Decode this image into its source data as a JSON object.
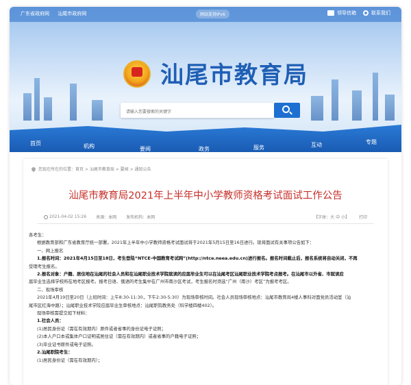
{
  "topbar": {
    "links": [
      "广东省政府网",
      "汕尾市政府网"
    ],
    "center": "网站支持IPv6",
    "email": "领导信箱",
    "contact": "联系我们"
  },
  "header": {
    "site_title": "汕尾市教育局",
    "search_placeholder": "请输入您要搜索的关键字"
  },
  "nav": {
    "items": [
      "首页",
      "机构",
      "要闻",
      "政务",
      "服务",
      "互动",
      "专题"
    ]
  },
  "breadcrumb": "您现在所在的位置：首页 > 汕尾市教育局 > 要闻 > 通知公告",
  "article": {
    "title": "汕尾市教育局2021年上半年中小学教师资格考试面试工作公告",
    "date": "2021-04-02 15:26",
    "source": "来源：本网",
    "publisher": "发布机构：本网",
    "font_size": "【字体：大 中 小】",
    "print": "打印",
    "paragraphs": [
      "各考生：",
      "根据教育部和广东省教育厅统一部署，2021年上半年中小学教师资格考试面试将于2021年5月15日至16日进行。现将面试有关事项公告如下：",
      "一、网上报名",
      "1.报名时间：2021年4月15日至18日，考生登陆“NTCE-中国教育考试网”(http://ntce.neea.edu.cn)进行报名。报名时间截止后，报名系统将自动关闭，不再",
      "受理考生报名。",
      "2.报名对象：户籍、居住地在汕尾的社会人员和在汕尾职业技术学院就读的应届毕业生可以在汕尾考区汕尾职业技术学院考点报考。在汕尾市以外省、市就读应",
      "届毕业生选择学校所在地考区报考。报考日语、俄语的考生集中在广州市南沙区考试，考生报名时须选“广州（南沙）考区”为报考考区。",
      "二、现场审核",
      "2021年4月19日至20日（上班时间：上午8:30-11:30，下午2:30-5:30）为现场审核时间。社会人员现场审核地点：汕尾市教育局4楼人事科对面党员活动室（汕",
      "尾市区红海中路）；汕尾职业技术学院应届毕业生审核地点：汕尾职院教务处（科学楼四楼402）。",
      "现场审核需提交如下材料：",
      "1.社会人员：",
      "(1)居民身份证（需在有效期内）原件或者省事的身份证电子证照；",
      "(2)本人户口本或集体户口证明或居住证（需在有效期内）或者省事的户籍电子证照；",
      "(3)毕业证书原件或电子证照。",
      "2.汕尾职院考生：",
      "(1)居民身份证（需在有效期内）；"
    ]
  },
  "colors": {
    "primary_blue": "#1d6fd1",
    "title_red": "#c62f2a",
    "site_title_blue": "#1f5fb5"
  }
}
